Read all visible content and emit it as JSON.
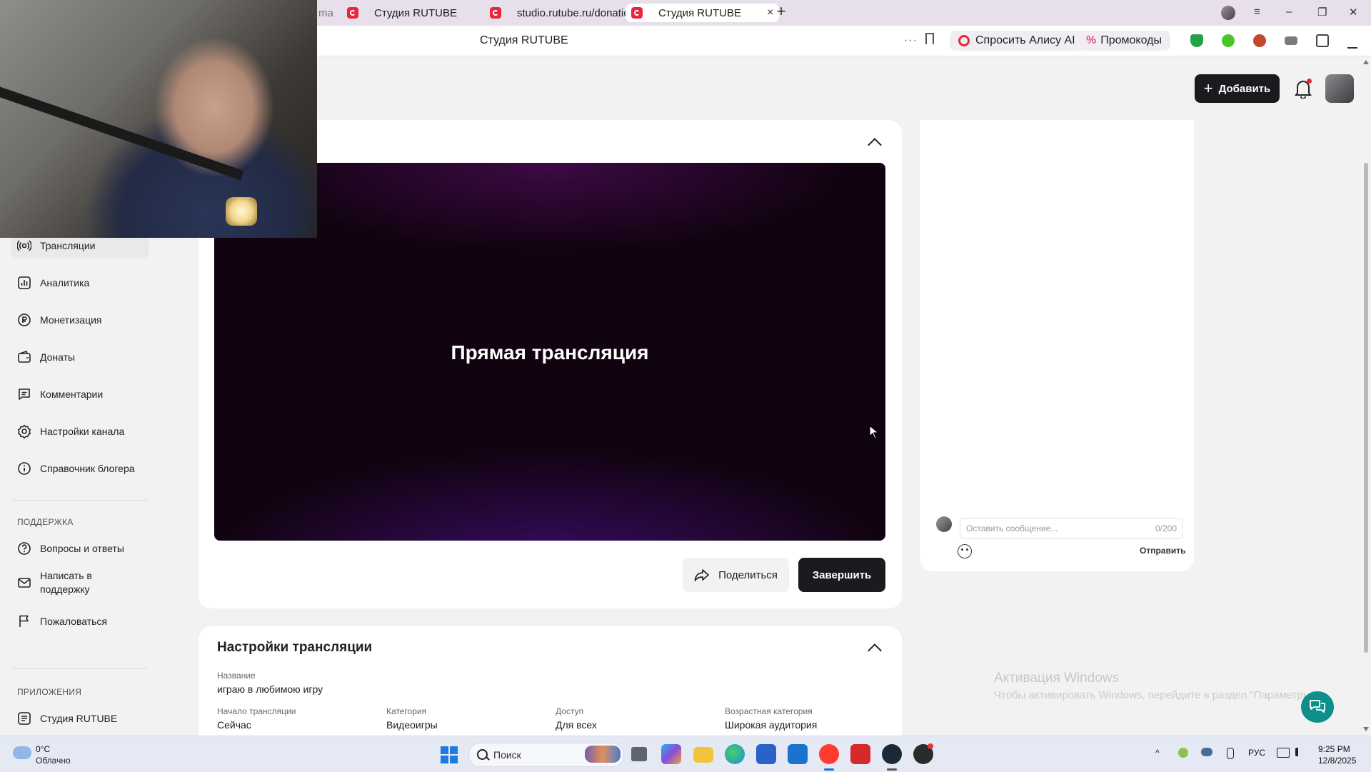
{
  "browser": {
    "tabs": [
      {
        "label": "ma",
        "active": false
      },
      {
        "label": "Студия RUTUBE",
        "active": false
      },
      {
        "label": "studio.rutube.ru/donation",
        "active": false
      },
      {
        "label": "Студия RUTUBE",
        "active": true
      }
    ],
    "close_glyph": "×",
    "new_tab_glyph": "+",
    "page_title": "Студия RUTUBE",
    "more_glyph": "···",
    "ask_alice": "Спросить Алису AI",
    "promo_symbol": "%",
    "promo": "Промокоды",
    "window_controls": [
      "≡",
      "–",
      "❐",
      "✕"
    ]
  },
  "header": {
    "add_plus": "+",
    "add_label": "Добавить"
  },
  "sidebar": {
    "items": [
      {
        "label": "Трансляции",
        "icon": "broadcast-icon",
        "active": true
      },
      {
        "label": "Аналитика",
        "icon": "analytics-icon",
        "active": false
      },
      {
        "label": "Монетизация",
        "icon": "ruble-icon",
        "active": false
      },
      {
        "label": "Донаты",
        "icon": "wallet-icon",
        "active": false
      },
      {
        "label": "Комментарии",
        "icon": "comment-icon",
        "active": false
      },
      {
        "label": "Настройки канала",
        "icon": "gear-icon",
        "active": false
      },
      {
        "label": "Справочник блогера",
        "icon": "info-icon",
        "active": false
      }
    ],
    "support_heading": "ПОДДЕРЖКА",
    "support_items": [
      {
        "label": "Вопросы и ответы",
        "icon": "help-icon"
      },
      {
        "label": "Написать в поддержку",
        "icon": "mail-icon"
      },
      {
        "label": "Пожаловаться",
        "icon": "flag-icon"
      }
    ],
    "apps_heading": "ПРИЛОЖЕНИЯ",
    "apps_items": [
      {
        "label": "Студия RUTUBE",
        "icon": "studio-icon"
      }
    ]
  },
  "player": {
    "title": "Прямая трансляция",
    "share_label": "Поделиться",
    "end_label": "Завершить"
  },
  "settings": {
    "title": "Настройки трансляции",
    "name_label": "Название",
    "name_value": "играю в любимою игру",
    "fields": [
      {
        "label": "Начало трансляции",
        "value": "Сейчас"
      },
      {
        "label": "Категория",
        "value": "Видеоигры"
      },
      {
        "label": "Доступ",
        "value": "Для всех"
      },
      {
        "label": "Возрастная категория",
        "value": "Широкая аудитория"
      }
    ]
  },
  "chat": {
    "placeholder": "Оставить сообщение...",
    "counter": "0/200",
    "send_label": "Отправить"
  },
  "watermark": {
    "line1": "Активация Windows",
    "line2": "Чтобы активировать Windows, перейдите в раздел \"Параметры\""
  },
  "taskbar": {
    "temperature": "0°C",
    "weather": "Облачно",
    "search_label": "Поиск",
    "language": "РУС",
    "time": "9:25 PM",
    "date": "12/8/2025"
  },
  "colors": {
    "accent": "#e8263c",
    "dark_button": "#1b1b1f",
    "fab": "#0f8f8a"
  }
}
